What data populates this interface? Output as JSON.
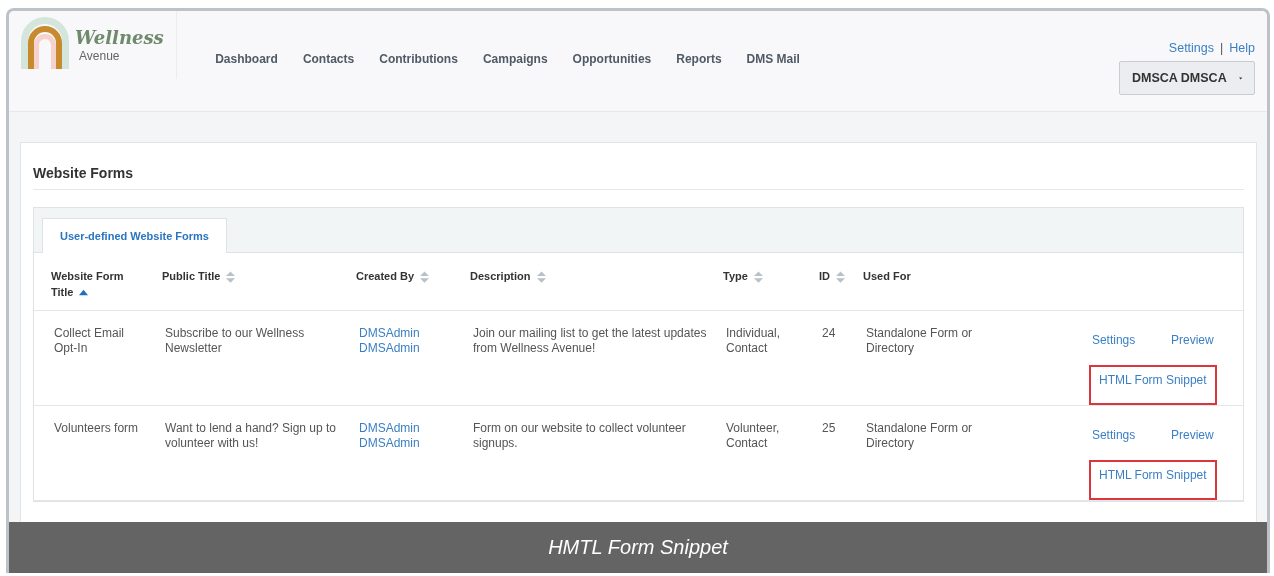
{
  "logo": {
    "name": "Wellness",
    "subtitle": "Avenue"
  },
  "nav": [
    "Dashboard",
    "Contacts",
    "Contributions",
    "Campaigns",
    "Opportunities",
    "Reports",
    "DMS Mail"
  ],
  "top_links": [
    "Settings",
    "Help"
  ],
  "separator": "|",
  "user_menu": {
    "label": "DMSCA DMSCA"
  },
  "page_title": "Website Forms",
  "tabs": [
    {
      "label": "User-defined Website Forms",
      "selected": true
    }
  ],
  "table": {
    "columns": [
      {
        "label": "Website Form Title",
        "kind": "sorted"
      },
      {
        "label": "Public Title",
        "kind": "sortable"
      },
      {
        "label": "Created By",
        "kind": "sortable"
      },
      {
        "label": "Description",
        "kind": "sortable"
      },
      {
        "label": "Type",
        "kind": "sortable"
      },
      {
        "label": "ID",
        "kind": "sortable"
      },
      {
        "label": "Used For",
        "kind": "plain"
      }
    ],
    "rows": [
      {
        "title": "Collect Email Opt-In",
        "public_title": "Subscribe to our Wellness Newsletter",
        "created_by": [
          "DMSAdmin",
          "DMSAdmin"
        ],
        "description": "Join our mailing list to get the latest updates from Wellness Avenue!",
        "type": "Individual, Contact",
        "id": "24",
        "used_for": "Standalone Form or Directory",
        "actions": [
          {
            "label": "Settings",
            "highlighted": false
          },
          {
            "label": "Preview",
            "highlighted": false
          },
          {
            "label": "HTML Form Snippet",
            "highlighted": true
          }
        ]
      },
      {
        "title": "Volunteers form",
        "public_title": "Want to lend a hand? Sign up to volunteer with us!",
        "created_by": [
          "DMSAdmin",
          "DMSAdmin"
        ],
        "description": "Form on our website to collect volunteer signups.",
        "type": "Volunteer, Contact",
        "id": "25",
        "used_for": "Standalone Form or Directory",
        "actions": [
          {
            "label": "Settings",
            "highlighted": false
          },
          {
            "label": "Preview",
            "highlighted": false
          },
          {
            "label": "HTML Form Snippet",
            "highlighted": true
          }
        ]
      }
    ]
  },
  "caption": "HMTL Form Snippet"
}
